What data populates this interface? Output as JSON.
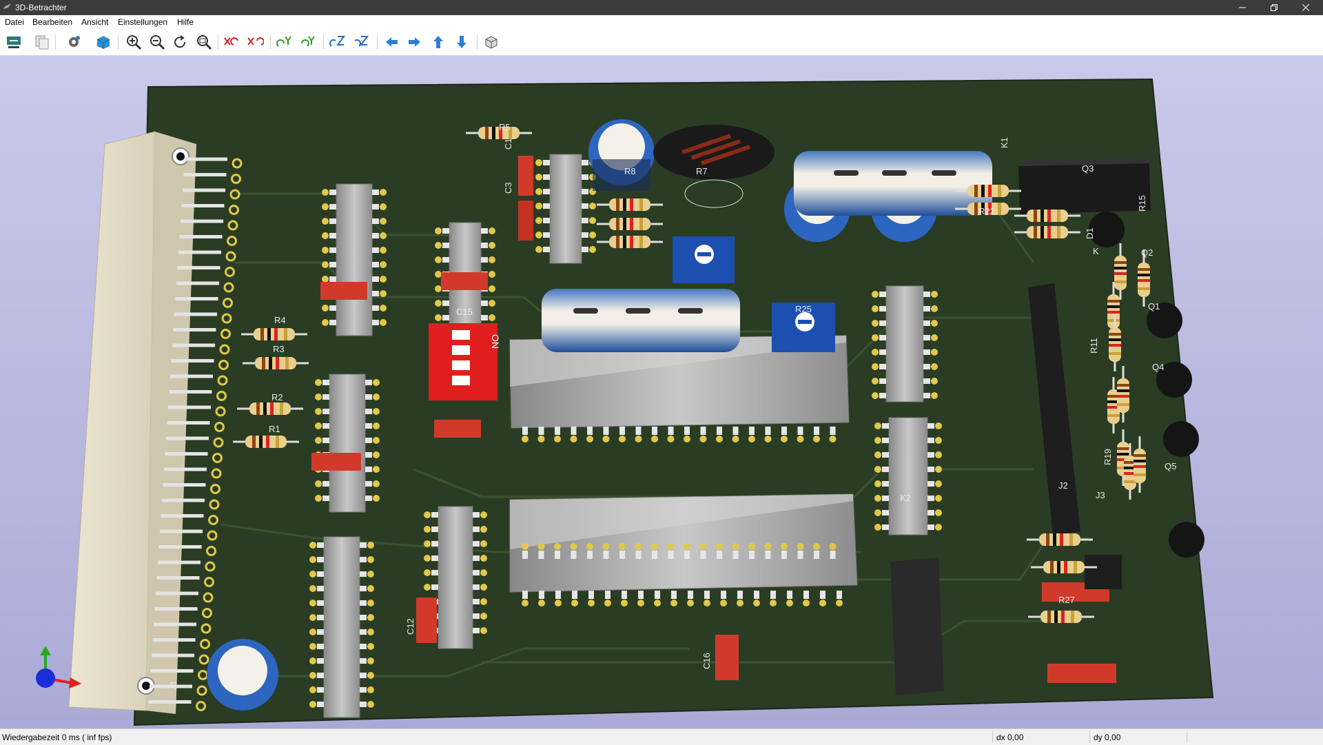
{
  "window": {
    "title": "3D-Betrachter"
  },
  "menu": [
    "Datei",
    "Bearbeiten",
    "Ansicht",
    "Einstellungen",
    "Hilfe"
  ],
  "toolbar": {
    "icons": [
      "reload-board-icon",
      "copy-image-icon",
      "settings-icon",
      "raytracing-icon",
      "zoom-in-icon",
      "zoom-out-icon",
      "redraw-icon",
      "zoom-fit-icon",
      "rotate-x-cw-icon",
      "rotate-x-ccw-icon",
      "rotate-y-cw-icon",
      "rotate-y-ccw-icon",
      "rotate-z-cw-icon",
      "rotate-z-ccw-icon",
      "move-left-icon",
      "move-right-icon",
      "move-up-icon",
      "move-down-icon",
      "ortho-projection-icon"
    ]
  },
  "board": {
    "labels": {
      "J1": "J1",
      "J2": "J2",
      "J3": "J3",
      "K1": "K1",
      "K2": "K2",
      "C1": "C1",
      "C3": "C3",
      "C12": "C12",
      "C15": "C15",
      "C16": "C16",
      "R1": "R1",
      "R2": "R2",
      "R3": "R3",
      "R4": "R4",
      "R5": "R5",
      "R7": "R7",
      "R8": "R8",
      "R11": "R11",
      "R15": "R15",
      "R19": "R19",
      "R22": "R22",
      "R25": "R25",
      "R27": "R27",
      "Q1": "Q1",
      "Q2": "Q2",
      "Q3": "Q3",
      "Q4": "Q4",
      "Q5": "Q5",
      "D1": "D1",
      "K": "K",
      "ON": "ON"
    },
    "colors": {
      "board": "#2a3d24",
      "background": "#b4b4de",
      "copper": "#e2c84a",
      "chip": "#a9a9a9",
      "capacitor": "#d13a2a"
    }
  },
  "status": {
    "render_time": "Wiedergabezeit 0 ms ( inf fps)",
    "dx": "dx 0,00",
    "dy": "dy 0,00"
  }
}
